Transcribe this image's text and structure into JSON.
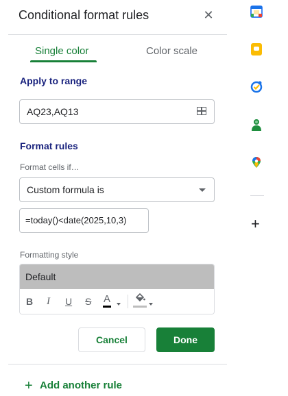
{
  "panel": {
    "title": "Conditional format rules",
    "close_glyph": "✕",
    "tabs": [
      {
        "label": "Single color",
        "active": true
      },
      {
        "label": "Color scale",
        "active": false
      }
    ],
    "apply_to_range": {
      "heading": "Apply to range",
      "value": "AQ23,AQ13",
      "icon": "grid-select-icon"
    },
    "format_rules": {
      "heading": "Format rules",
      "condition_label": "Format cells if…",
      "condition_value": "Custom formula is",
      "formula_value": "=today()<date(2025,10,3)"
    },
    "formatting_style": {
      "label": "Formatting style",
      "preview_text": "Default",
      "preview_bg": "#bdbdbd",
      "toolbar": {
        "bold": "B",
        "italic": "I",
        "underline": "U",
        "strikethrough": "S",
        "text_color": "A"
      }
    },
    "buttons": {
      "cancel": "Cancel",
      "done": "Done"
    },
    "add_rule": {
      "plus": "+",
      "label": "Add another rule"
    }
  },
  "colors": {
    "accent_green": "#188038",
    "heading_navy": "#1a237e",
    "border": "#dadce0"
  },
  "right_rail": {
    "icons": [
      "calendar-icon",
      "keep-icon",
      "tasks-icon",
      "contacts-icon",
      "maps-icon"
    ],
    "add_glyph": "+"
  }
}
